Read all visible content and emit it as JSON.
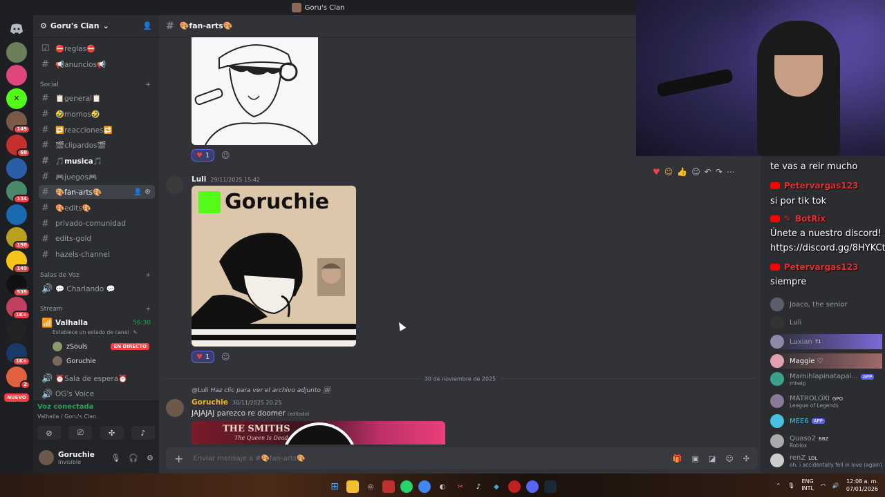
{
  "window": {
    "title": "Goru's Clan"
  },
  "servers": {
    "badges": [
      "149",
      "68",
      "134",
      "198",
      "149",
      "539",
      "1K+",
      "1K+",
      "2"
    ],
    "new_label": "NUEVO"
  },
  "guild": {
    "name": "Goru's Clan"
  },
  "channels": {
    "top": [
      {
        "icon": "rules-icon",
        "label": "⛔reglas⛔"
      },
      {
        "icon": "hash",
        "label": "📢anuncios📢"
      }
    ],
    "social_label": "Social",
    "social": [
      {
        "label": "📋general📋"
      },
      {
        "label": "🤣momos🤣"
      },
      {
        "label": "🔁reacciones🔁"
      },
      {
        "label": "🎬clipardos🎬"
      },
      {
        "label": "🎵musica🎵"
      },
      {
        "label": "🎮juegos🎮"
      },
      {
        "label": "🎨fan-arts🎨"
      },
      {
        "label": "🎨edits🎨"
      },
      {
        "label": "privado-comunidad"
      },
      {
        "label": "edits-gold"
      },
      {
        "label": "hazels-channel"
      }
    ],
    "voice_label": "Salas de Voz",
    "voice": [
      {
        "label": "💬 Charlando 💬"
      }
    ],
    "stream_label": "Stream",
    "stream_channel": {
      "label": "Valhalla",
      "time": "56:30",
      "status": "Establece un estado de canal"
    },
    "stream_users": [
      {
        "name": "zSouls",
        "badge": "EN DIRECTO"
      },
      {
        "name": "Goruchie"
      }
    ],
    "after": [
      {
        "label": "⏰Sala de espera⏰"
      },
      {
        "label": "OG's Voice"
      }
    ]
  },
  "voice_bar": {
    "title": "Voz conectada",
    "sub": "Valhalla / Goru's Clan"
  },
  "user_panel": {
    "name": "Goruchie",
    "status": "Invisible"
  },
  "channel_header": {
    "name": "🎨fan-arts🎨"
  },
  "messages": {
    "reaction1_count": "1",
    "msg2_author": "Luli",
    "msg2_time": "29/11/2025 15:42",
    "image2_logo": "Goruchie",
    "reaction2_count": "1",
    "date_divider": "30 de noviembre de 2025",
    "reply_user": "@Luli",
    "reply_text": "Haz clic para ver el archivo adjunto",
    "msg3_author": "Goruchie",
    "msg3_time": "30/11/2025 20:25",
    "msg3_text": "JAJAJAJ parezco re doomer",
    "msg3_edited": "(editado)",
    "image3_band": "THE SMITHS",
    "image3_album": "The Queen Is Dead"
  },
  "composer": {
    "placeholder": "Enviar mensaje a #🎨fan-arts🎨"
  },
  "stream_chat": [
    {
      "type": "text",
      "text": "te vas a reir mucho"
    },
    {
      "type": "user",
      "text": "Petervargas123"
    },
    {
      "type": "text",
      "text": "si por tik tok"
    },
    {
      "type": "user",
      "text": "BotRix"
    },
    {
      "type": "text",
      "text": "Únete a nuestro discord!"
    },
    {
      "type": "text",
      "text": "https://discord.gg/8HYKCt"
    },
    {
      "type": "user",
      "text": "Petervargas123"
    },
    {
      "type": "text",
      "text": "siempre"
    }
  ],
  "members": [
    {
      "name": "Joaco, the senior",
      "status": ""
    },
    {
      "name": "Luli",
      "status": ""
    },
    {
      "name": "Luxian",
      "tag": "T1",
      "status": ""
    },
    {
      "name": "Maggie ♡",
      "status": ""
    },
    {
      "name": "Mamihlapinatapai...",
      "tag": "APP",
      "status": "mhelp"
    },
    {
      "name": "MATROLOXI",
      "tag": "GPO",
      "status": "League of Legends"
    },
    {
      "name": "MEE6",
      "tag": "APP",
      "status": ""
    },
    {
      "name": "Quaso2",
      "tag": "BBZ",
      "status": "Roblox"
    },
    {
      "name": "renZ",
      "tag": "LOL",
      "status": "oh, i accidentally fell in love (again)"
    }
  ],
  "tray": {
    "lang": "ENG",
    "layout": "INTL",
    "time": "12:08 a. m.",
    "date": "07/01/2026"
  },
  "colors": {
    "accent": "#5865f2",
    "live": "#f23f43",
    "connected": "#23a559",
    "goruchie": "#f0b232"
  }
}
